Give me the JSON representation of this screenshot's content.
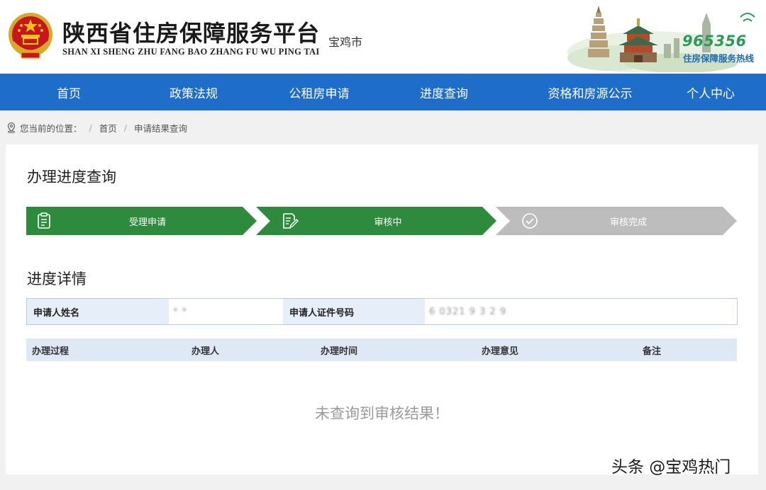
{
  "header": {
    "title": "陕西省住房保障服务平台",
    "subtitle": "SHAN XI SHENG ZHU FANG BAO ZHANG FU WU PING TAI",
    "city": "宝鸡市",
    "hotline_number": "965356",
    "hotline_label": "住房保障服务热线"
  },
  "nav": {
    "items": [
      "首页",
      "政策法规",
      "公租房申请",
      "进度查询",
      "资格和房源公示",
      "个人中心"
    ]
  },
  "breadcrumb": {
    "prefix": "您当前的位置：",
    "items": [
      "首页",
      "申请结果查询"
    ]
  },
  "main": {
    "title": "办理进度查询",
    "steps": [
      {
        "label": "受理申请",
        "status": "done",
        "icon": "clipboard-icon"
      },
      {
        "label": "审核中",
        "status": "active",
        "icon": "edit-document-icon"
      },
      {
        "label": "审核完成",
        "status": "pending",
        "icon": "check-circle-icon"
      }
    ],
    "detail_title": "进度详情",
    "applicant_name_label": "申请人姓名",
    "applicant_name_value": "*  *",
    "applicant_id_label": "申请人证件号码",
    "applicant_id_value": "6  0321  9  3  2  9",
    "columns": [
      "办理过程",
      "办理人",
      "办理时间",
      "办理意见",
      "备注"
    ],
    "empty_message": "未查询到审核结果！"
  },
  "watermark": "头条 @宝鸡热门",
  "colors": {
    "nav_bg": "#1e6ec9",
    "step_done": "#2e8b3e",
    "step_pending": "#bdbdbd",
    "table_header_bg": "#dfe9f6",
    "hotline_green": "#2b9a5a"
  }
}
